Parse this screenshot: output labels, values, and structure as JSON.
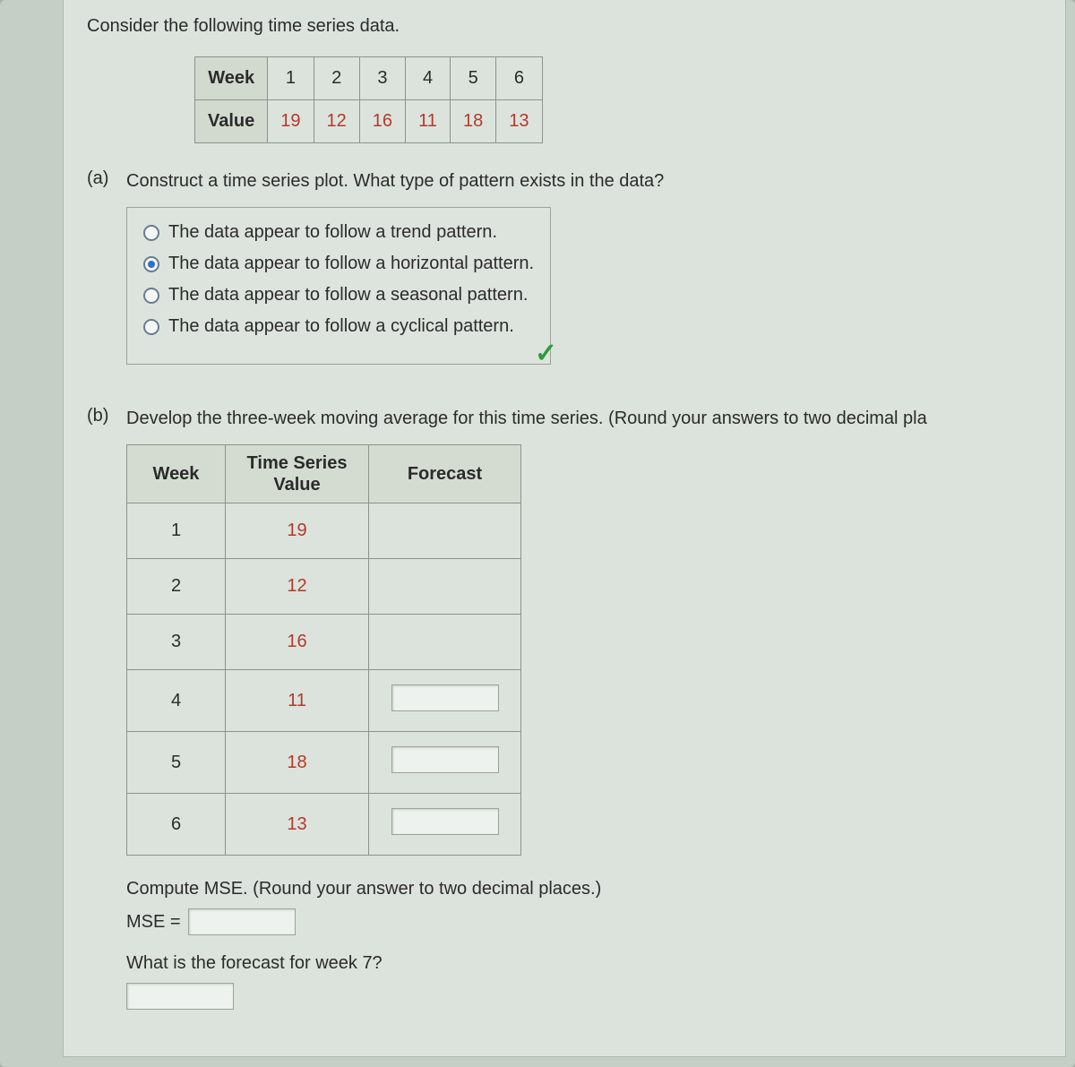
{
  "intro": "Consider the following time series data.",
  "dataTable": {
    "headers": [
      "Week",
      "Value"
    ],
    "weeks": [
      "1",
      "2",
      "3",
      "4",
      "5",
      "6"
    ],
    "values": [
      "19",
      "12",
      "16",
      "11",
      "18",
      "13"
    ]
  },
  "partA": {
    "label": "(a)",
    "question": "Construct a time series plot. What type of pattern exists in the data?",
    "options": [
      "The data appear to follow a trend pattern.",
      "The data appear to follow a horizontal pattern.",
      "The data appear to follow a seasonal pattern.",
      "The data appear to follow a cyclical pattern."
    ],
    "selectedIndex": 1
  },
  "partB": {
    "label": "(b)",
    "question": "Develop the three-week moving average for this time series. (Round your answers to two decimal pla",
    "tableHeaders": {
      "week": "Week",
      "ts": "Time Series\nValue",
      "forecast": "Forecast"
    },
    "rows": [
      {
        "week": "1",
        "value": "19",
        "hasInput": false
      },
      {
        "week": "2",
        "value": "12",
        "hasInput": false
      },
      {
        "week": "3",
        "value": "16",
        "hasInput": false
      },
      {
        "week": "4",
        "value": "11",
        "hasInput": true
      },
      {
        "week": "5",
        "value": "18",
        "hasInput": true
      },
      {
        "week": "6",
        "value": "13",
        "hasInput": true
      }
    ],
    "msePrompt": "Compute MSE. (Round your answer to two decimal places.)",
    "mseLabel": "MSE =",
    "week7Prompt": "What is the forecast for week 7?"
  }
}
